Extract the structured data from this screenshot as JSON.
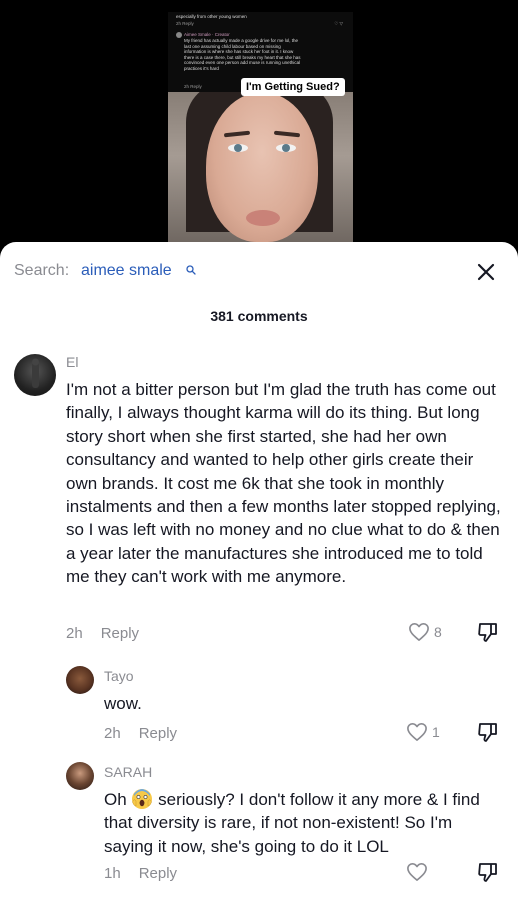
{
  "video": {
    "overlay_header": "especially from other young women",
    "overlay_reply_top": "2h   Reply",
    "overlay_comment_name": "Aimee Smale · Creator",
    "overlay_comment_text": "My friend has actually made a google drive for me lol, the last one assuming child labour based on missing information is where she has stuck her foot in it. I know there is a case there, but still breaks my heart that she has convinced even one person add muse is running unethical practices it's hard",
    "overlay_reply_bottom": "2h   Reply",
    "sticker_text": "I'm Getting Sued?"
  },
  "search": {
    "prefix": "Search:",
    "term": "aimee smale"
  },
  "comment_count": "381 comments",
  "comments": [
    {
      "name": "El",
      "text": "I'm not a bitter person but I'm glad the truth has come out finally, I always thought karma will do its thing. But long story short when she first started, she had her own consultancy and wanted to help other girls create their own brands. It cost me 6k that she took in monthly instalments and then a few months later stopped replying, so I was left with no money and no clue what to do & then a year later the manufactures she introduced me to told me they can't work with me anymore.",
      "time": "2h",
      "reply_label": "Reply",
      "likes": "8"
    },
    {
      "name": "Tayo",
      "text": "wow.",
      "time": "2h",
      "reply_label": "Reply",
      "likes": "1"
    },
    {
      "name": "SARAH",
      "text_before": "Oh",
      "text_after": "seriously? I don't follow it any more & I find that diversity is rare, if not non-existent! So I'm saying it now, she's going to do it LOL",
      "time": "1h",
      "reply_label": "Reply",
      "likes": ""
    }
  ]
}
